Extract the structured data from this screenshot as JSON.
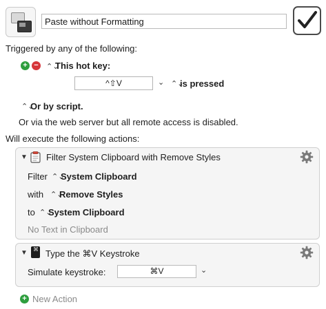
{
  "macro": {
    "name": "Paste without Formatting",
    "enabled": true
  },
  "triggers": {
    "heading": "Triggered by any of the following:",
    "hotkey_label": "This hot key:",
    "hotkey_value": "^⇧V",
    "hotkey_state": "is pressed",
    "script_label": "Or by script.",
    "web_note": "Or via the web server but all remote access is disabled."
  },
  "actions": {
    "heading": "Will execute the following actions:",
    "items": [
      {
        "title": "Filter System Clipboard with Remove Styles",
        "filter_label": "Filter",
        "filter_value": "System Clipboard",
        "with_label": "with",
        "with_value": "Remove Styles",
        "to_label": "to",
        "to_value": "System Clipboard",
        "status": "No Text in Clipboard"
      },
      {
        "title": "Type the ⌘V Keystroke",
        "keystroke_label": "Simulate keystroke:",
        "keystroke_value": "⌘V"
      }
    ],
    "new_action_label": "New Action"
  },
  "colors": {
    "add": "#2e9e3e",
    "remove": "#d6353a"
  }
}
